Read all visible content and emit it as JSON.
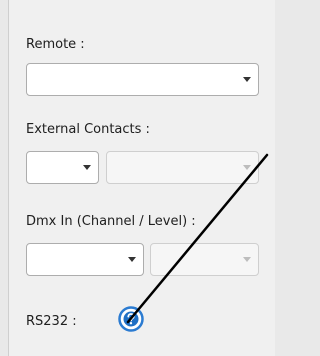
{
  "remote": {
    "label": "Remote :",
    "value": ""
  },
  "external_contacts": {
    "label": "External Contacts :",
    "first_value": "",
    "second_value": ""
  },
  "dmx_in": {
    "label": "Dmx In (Channel / Level) :",
    "channel_value": "",
    "level_value": ""
  },
  "rs232": {
    "label": "RS232 :",
    "help_icon": "question-help-icon"
  },
  "colors": {
    "help_blue": "#2b7bd1",
    "annotation_line": "#000000"
  }
}
